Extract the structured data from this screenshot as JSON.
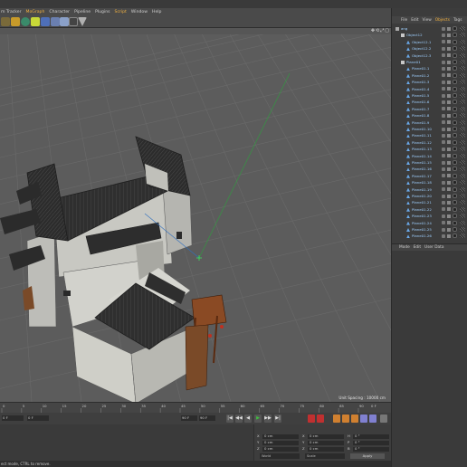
{
  "menubar": {
    "items": [
      "m Tracker",
      "MoGraph",
      "Character",
      "Pipeline",
      "Plugins",
      "Script",
      "Window",
      "Help"
    ],
    "highlight": [
      "MoGraph",
      "Script"
    ]
  },
  "toolbar": {
    "icons": [
      "render-region-icon",
      "render-view-icon",
      "edit-render-settings-icon",
      "cube-icon",
      "spline-pen-icon",
      "nurbs-icon",
      "array-icon",
      "deformer-icon",
      "scene-icon",
      "camera-icon",
      "light-icon"
    ]
  },
  "viewport": {
    "nav_icons": [
      "✥",
      "⟲",
      "⤢",
      "▢"
    ],
    "unit_spacing": "Unit Spacing : 10000 cm"
  },
  "timeline": {
    "ticks": [
      "0",
      "5",
      "10",
      "15",
      "20",
      "25",
      "30",
      "35",
      "40",
      "45",
      "50",
      "55",
      "60",
      "65",
      "70",
      "75",
      "80",
      "85",
      "90"
    ],
    "end_label": "0 F"
  },
  "transport": {
    "start_frame": "0 F",
    "current_frame": "0 F",
    "end_frame": "90 F",
    "end_frame2": "90 F",
    "buttons": [
      "|◀",
      "◀◀",
      "◀",
      "▶",
      "▶▶",
      "▶|"
    ]
  },
  "coords": {
    "rows": [
      {
        "a": "X",
        "v1": "0 cm",
        "b": "X",
        "v2": "0 cm",
        "c": "H",
        "v3": "0 °"
      },
      {
        "a": "Y",
        "v1": "0 cm",
        "b": "Y",
        "v2": "0 cm",
        "c": "P",
        "v3": "0 °"
      },
      {
        "a": "Z",
        "v1": "0 cm",
        "b": "Z",
        "v2": "0 cm",
        "c": "B",
        "v3": "0 °"
      }
    ],
    "drop1": "World",
    "drop2": "Scale",
    "apply": "Apply"
  },
  "statusbar": {
    "text": "ect mode, CTRL to remove."
  },
  "objects_panel": {
    "menu": [
      "File",
      "Edit",
      "View",
      "Objects",
      "Tags"
    ],
    "active_menu": "Objects",
    "items": [
      {
        "name": "ang",
        "indent": 0,
        "kind": "layer"
      },
      {
        "name": "Object12",
        "indent": 1,
        "kind": "null"
      },
      {
        "name": "Object12.1",
        "indent": 2,
        "kind": "mesh"
      },
      {
        "name": "Object12.2",
        "indent": 2,
        "kind": "mesh"
      },
      {
        "name": "Object12.3",
        "indent": 2,
        "kind": "mesh"
      },
      {
        "name": "Plane01",
        "indent": 1,
        "kind": "null"
      },
      {
        "name": "Plane01.1",
        "indent": 2,
        "kind": "mesh"
      },
      {
        "name": "Plane01.2",
        "indent": 2,
        "kind": "mesh"
      },
      {
        "name": "Plane01.3",
        "indent": 2,
        "kind": "mesh"
      },
      {
        "name": "Plane01.4",
        "indent": 2,
        "kind": "mesh"
      },
      {
        "name": "Plane01.5",
        "indent": 2,
        "kind": "mesh"
      },
      {
        "name": "Plane01.6",
        "indent": 2,
        "kind": "mesh"
      },
      {
        "name": "Plane01.7",
        "indent": 2,
        "kind": "mesh"
      },
      {
        "name": "Plane01.8",
        "indent": 2,
        "kind": "mesh"
      },
      {
        "name": "Plane01.9",
        "indent": 2,
        "kind": "mesh"
      },
      {
        "name": "Plane01.10",
        "indent": 2,
        "kind": "mesh"
      },
      {
        "name": "Plane01.11",
        "indent": 2,
        "kind": "mesh"
      },
      {
        "name": "Plane01.12",
        "indent": 2,
        "kind": "mesh"
      },
      {
        "name": "Plane01.13",
        "indent": 2,
        "kind": "mesh"
      },
      {
        "name": "Plane01.14",
        "indent": 2,
        "kind": "mesh"
      },
      {
        "name": "Plane01.15",
        "indent": 2,
        "kind": "mesh"
      },
      {
        "name": "Plane01.16",
        "indent": 2,
        "kind": "mesh"
      },
      {
        "name": "Plane01.17",
        "indent": 2,
        "kind": "mesh"
      },
      {
        "name": "Plane01.18",
        "indent": 2,
        "kind": "mesh"
      },
      {
        "name": "Plane01.19",
        "indent": 2,
        "kind": "mesh"
      },
      {
        "name": "Plane01.20",
        "indent": 2,
        "kind": "mesh"
      },
      {
        "name": "Plane01.21",
        "indent": 2,
        "kind": "mesh"
      },
      {
        "name": "Plane01.22",
        "indent": 2,
        "kind": "mesh"
      },
      {
        "name": "Plane01.23",
        "indent": 2,
        "kind": "mesh"
      },
      {
        "name": "Plane01.24",
        "indent": 2,
        "kind": "mesh"
      },
      {
        "name": "Plane01.25",
        "indent": 2,
        "kind": "mesh"
      },
      {
        "name": "Plane01.26",
        "indent": 2,
        "kind": "mesh"
      }
    ]
  },
  "attributes_panel": {
    "menu": [
      "Mode",
      "Edit",
      "User Data"
    ]
  },
  "colors": {
    "accent": "#f0b040",
    "object_name": "#9fd0ff",
    "viewport_bg": "#5c5c5c",
    "play_green": "#3fbf3f"
  }
}
